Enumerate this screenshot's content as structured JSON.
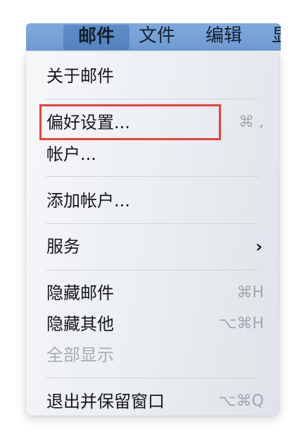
{
  "menubar": {
    "items": [
      "邮件",
      "文件",
      "编辑",
      "显示"
    ],
    "active_index": 0
  },
  "menu": {
    "about": "关于邮件",
    "preferences": "偏好设置...",
    "preferences_shortcut": "⌘ ,",
    "accounts": "帐户...",
    "add_account": "添加帐户...",
    "services": "服务",
    "services_arrow": "›",
    "hide_mail": "隐藏邮件",
    "hide_mail_shortcut": "⌘H",
    "hide_others": "隐藏其他",
    "hide_others_shortcut": "⌥⌘H",
    "show_all": "全部显示",
    "quit_keep_windows": "退出并保留窗口",
    "quit_keep_windows_shortcut": "⌥⌘Q"
  },
  "colors": {
    "menubar": "#7ea9dc",
    "highlight_box": "#e8413a"
  }
}
